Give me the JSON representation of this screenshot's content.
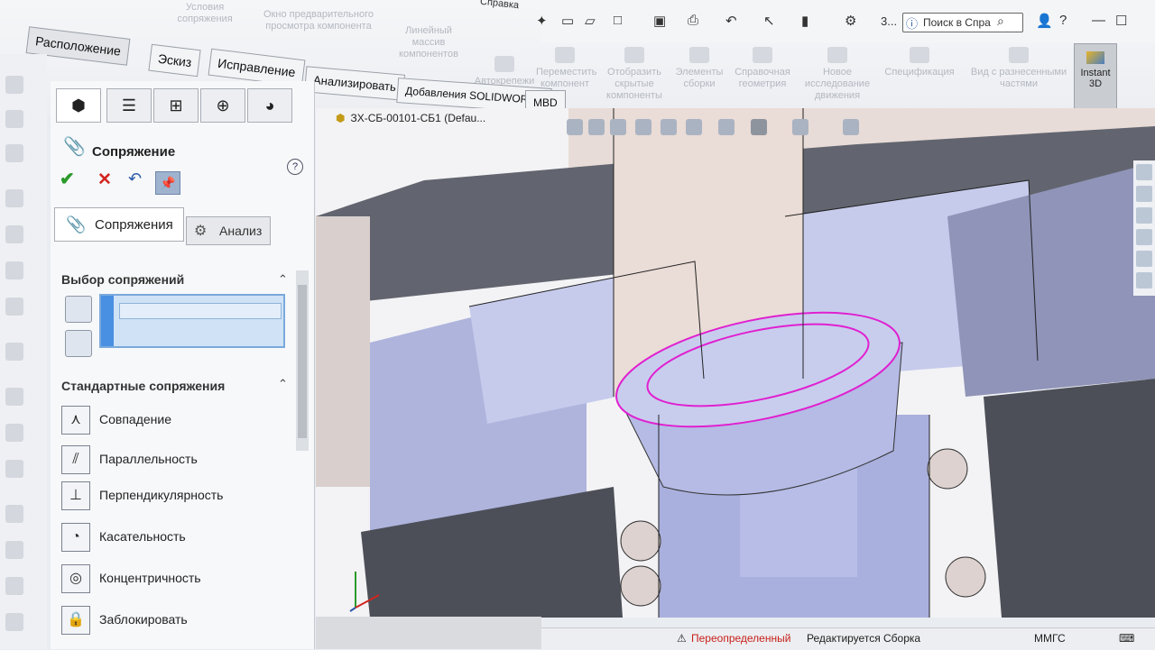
{
  "ribbon": {
    "faded_items": [
      "Условия сопряжения",
      "Окно предварительного просмотра компонента",
      "Линейный массив компонентов",
      "Автокрепежи",
      "Переместить компонент",
      "Отобразить скрытые компоненты",
      "Элементы сборки",
      "Справочная геометрия",
      "Новое исследование движения",
      "Спецификация",
      "Вид с разнесенными частями"
    ],
    "help_menu": "Справка",
    "instant3d": "Instant 3D"
  },
  "titlebar": {
    "search_placeholder": "Поиск в Спра",
    "count": "3..."
  },
  "tabs": [
    "Расположение",
    "Эскиз",
    "Исправление",
    "Анализировать",
    "Добавления SOLIDWORKS",
    "MBD"
  ],
  "property_manager": {
    "title": "Сопряжение",
    "subtab_mates": "Сопряжения",
    "subtab_analysis": "Анализ",
    "section_selection": "Выбор сопряжений",
    "section_standard": "Стандартные сопряжения",
    "standard_mates": [
      {
        "label": "Совпадение",
        "icon": "coincident-icon"
      },
      {
        "label": "Параллельность",
        "icon": "parallel-icon"
      },
      {
        "label": "Перпендикулярность",
        "icon": "perpendicular-icon"
      },
      {
        "label": "Касательность",
        "icon": "tangent-icon"
      },
      {
        "label": "Концентричность",
        "icon": "concentric-icon"
      },
      {
        "label": "Заблокировать",
        "icon": "lock-icon"
      }
    ]
  },
  "document": {
    "name": "ЗХ-СБ-00101-СБ1",
    "config": "(Defau..."
  },
  "status": {
    "warning": "Переопределенный",
    "editing": "Редактируется Сборка",
    "units": "ММГС"
  },
  "colors": {
    "accent": "#4a90e2",
    "selection_highlight": "#e020d0",
    "part_fill": "#b8bfe6",
    "dark_part": "#4c4f58"
  }
}
